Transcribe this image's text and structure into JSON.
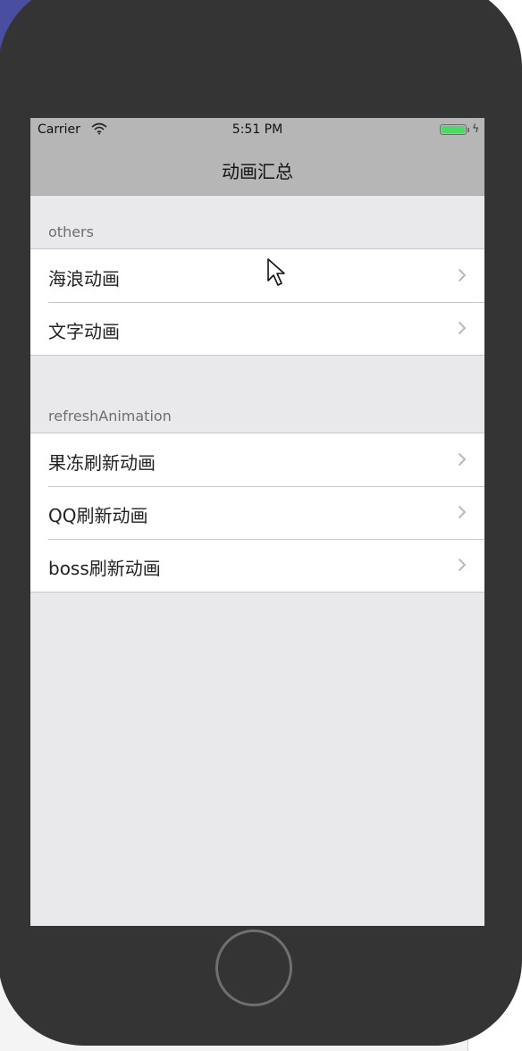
{
  "status_bar": {
    "carrier": "Carrier",
    "time": "5:51 PM",
    "battery_level": 1.0,
    "icons": [
      "wifi-icon",
      "battery-icon",
      "charging-bolt-icon"
    ]
  },
  "nav_bar": {
    "title": "动画汇总"
  },
  "sections": [
    {
      "header": "others",
      "rows": [
        {
          "label": "海浪动画",
          "accessory": "chevron-right-icon"
        },
        {
          "label": "文字动画",
          "accessory": "chevron-right-icon"
        }
      ]
    },
    {
      "header": "refreshAnimation",
      "rows": [
        {
          "label": "果冻刷新动画",
          "accessory": "chevron-right-icon"
        },
        {
          "label": "QQ刷新动画",
          "accessory": "chevron-right-icon"
        },
        {
          "label": "boss刷新动画",
          "accessory": "chevron-right-icon"
        }
      ]
    }
  ],
  "colors": {
    "nav_background": "#b6b6b6",
    "table_background": "#e9e9ec",
    "battery_green": "#4cd964",
    "phone_body": "#343434"
  }
}
